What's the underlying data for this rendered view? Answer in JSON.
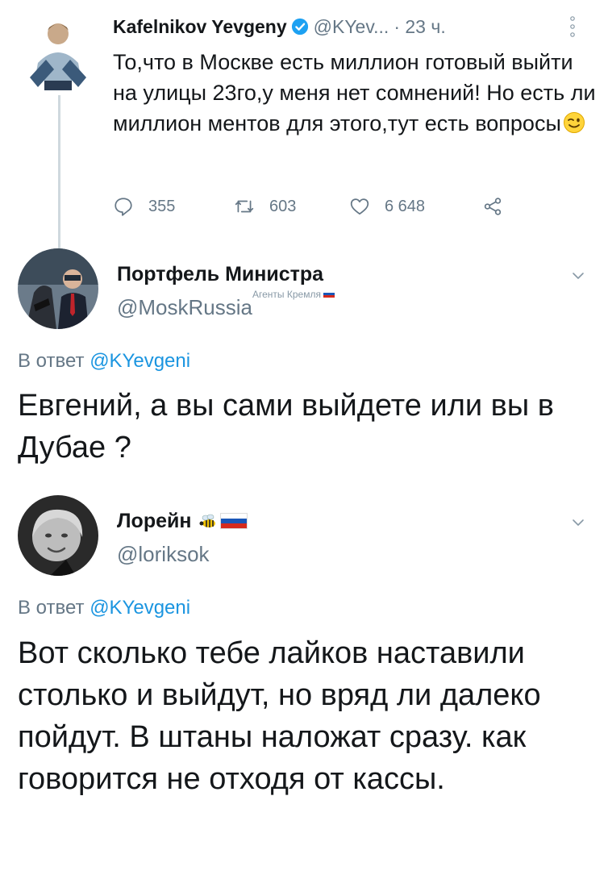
{
  "tweet": {
    "author_name": "Kafelnikov Yevgeny",
    "handle": "@KYev...",
    "time": "· 23 ч.",
    "text": "То,что в Москве есть миллион готовый выйти на улицы 23го,у меня нет сомнений! Но есть ли миллион ментов для этого,тут есть вопросы",
    "stats": {
      "replies": "355",
      "retweets": "603",
      "likes": "6 648"
    }
  },
  "replies": [
    {
      "author_name": "Портфель Министра",
      "handle": "@MoskRussia",
      "label": "Агенты Кремля",
      "reply_to_prefix": "В ответ ",
      "reply_to_handle": "@KYevgeni",
      "text": "Евгений, а вы сами выйдете или вы в Дубае ?"
    },
    {
      "author_name": "Лорейн",
      "handle": "@loriksok",
      "reply_to_prefix": "В ответ ",
      "reply_to_handle": "@KYevgeni",
      "text": "Вот сколько тебе лайков наставили столько и выйдут, но вряд ли далеко пойдут. В штаны наложат сразу. как говорится не отходя от кассы."
    }
  ],
  "icons": {
    "verified": "verified-badge-icon",
    "reply": "reply-icon",
    "retweet": "retweet-icon",
    "like": "heart-icon",
    "share": "share-icon",
    "more": "more-vertical-icon",
    "chevron": "chevron-down-icon"
  },
  "colors": {
    "link": "#1b95e0",
    "secondary_text": "#657786",
    "primary_text": "#14171a"
  }
}
